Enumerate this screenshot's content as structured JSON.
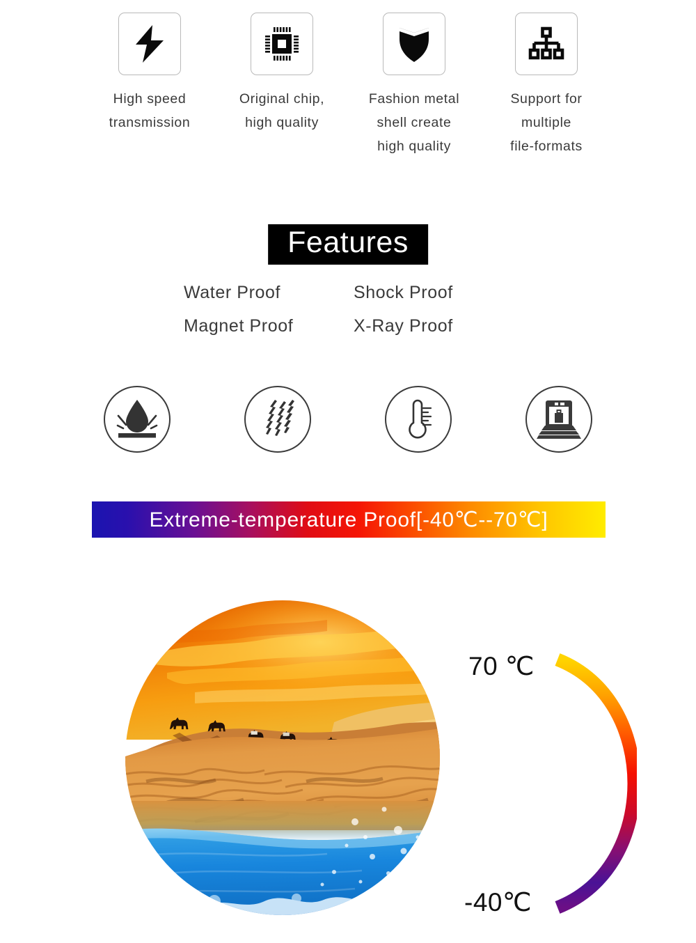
{
  "top_features": [
    {
      "icon": "lightning-bolt-icon",
      "caption": "High speed\ntransmission"
    },
    {
      "icon": "cpu-chip-icon",
      "caption": "Original chip,\nhigh quality"
    },
    {
      "icon": "shield-icon",
      "caption": "Fashion metal\nshell create\nhigh quality"
    },
    {
      "icon": "sitemap-icon",
      "caption": "Support for\nmultiple\nfile-formats"
    }
  ],
  "features_section": {
    "title": "Features",
    "proofs": [
      "Water Proof",
      "Shock Proof",
      "Magnet Proof",
      "X-Ray Proof"
    ]
  },
  "proof_icons": [
    {
      "icon": "water-drop-splash-icon",
      "label": "water-proof"
    },
    {
      "icon": "shock-vibration-icon",
      "label": "shock-proof"
    },
    {
      "icon": "thermometer-icon",
      "label": "temperature-proof"
    },
    {
      "icon": "xray-scanner-icon",
      "label": "x-ray-proof"
    }
  ],
  "temperature_banner": {
    "text": "Extreme-temperature Proof[-40℃--70℃]",
    "gradient_start": "#1a14b0",
    "gradient_mid": "#f51505",
    "gradient_end": "#ffec00",
    "text_color": "#ffffff"
  },
  "scene": {
    "description": "desert-sunset-camel-caravan-over-water",
    "sky_color": "#e8730a",
    "sand_color": "#e09a43",
    "water_color": "#1a8fe0"
  },
  "temperature_gauge": {
    "hot_label": "70 ℃",
    "cold_label": "-40℃",
    "arc_top_color": "#ffd400",
    "arc_mid_color": "#f01000",
    "arc_bottom_color": "#5a1090"
  }
}
